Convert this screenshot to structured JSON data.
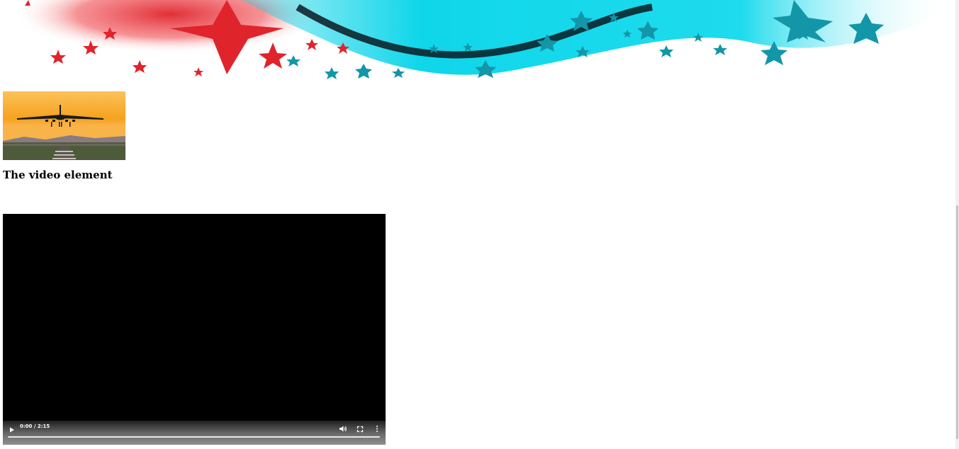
{
  "banner": {
    "alt": "Decorative banner of red and teal stars on a swirl"
  },
  "image": {
    "alt": "Airplane landing at sunset"
  },
  "heading": "The video element",
  "video": {
    "time_display": "0:00 / 2:15",
    "progress": 0
  },
  "icons": {
    "play": "play-icon",
    "volume": "volume-icon",
    "fullscreen": "fullscreen-icon",
    "more": "more-options-icon"
  },
  "colors": {
    "star_red": "#e0242c",
    "star_teal": "#1396a8",
    "swirl_cyan": "#12d4e8",
    "sky_orange": "#f6a21e"
  }
}
